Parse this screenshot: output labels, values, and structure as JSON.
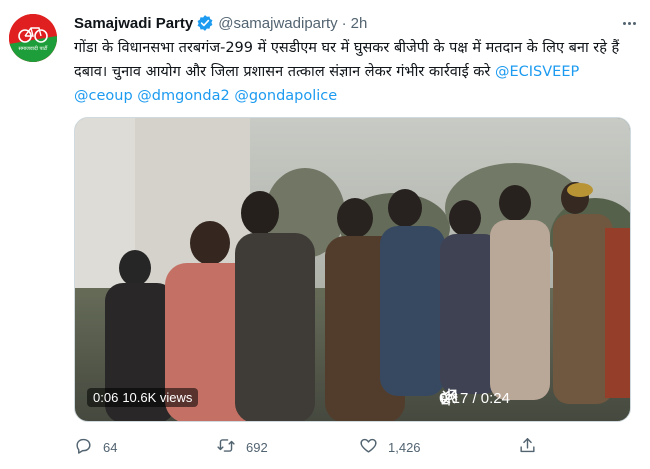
{
  "tweet": {
    "author_name": "Samajwadi Party",
    "author_handle": "@samajwadiparty",
    "separator": "·",
    "time": "2h",
    "text": "गोंडा के विधानसभा तरबगंज-299 में एसडीएम घर में घुसकर बीजेपी के पक्ष में मतदान के लिए बना रहे हैं दबाव। चुनाव आयोग और जिला प्रशासन तत्काल संज्ञान लेकर गंभीर कार्रवाई करे",
    "mentions": [
      "@ECISVEEP",
      "@ceoup",
      "@dmgonda2",
      "@gondapolice"
    ],
    "avatar_label": "समाजवादी पार्टी"
  },
  "video": {
    "elapsed_badge": "0:06",
    "views": "10.6K views",
    "position": "0:17 / 0:24"
  },
  "actions": {
    "replies": "64",
    "retweets": "692",
    "likes": "1,426"
  },
  "icons": {
    "verified": "verified-badge-icon",
    "more": "more-icon",
    "reply": "reply-icon",
    "retweet": "retweet-icon",
    "like": "heart-icon",
    "share": "share-icon",
    "mute": "mute-icon",
    "settings": "gear-icon",
    "fullscreen": "fullscreen-icon"
  },
  "colors": {
    "accent": "#1d9bf0",
    "muted": "#536471",
    "avatar_bg": "#e02020"
  }
}
